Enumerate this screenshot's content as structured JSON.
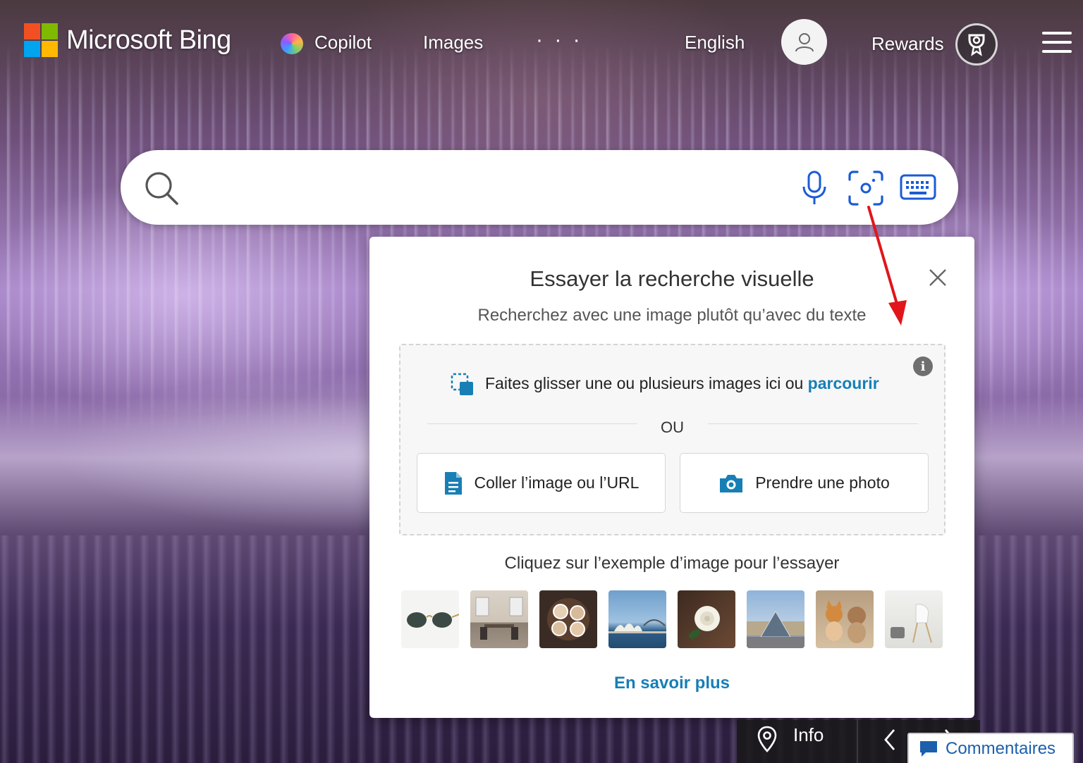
{
  "header": {
    "brand": "Microsoft Bing",
    "brand_colors": [
      "#f25022",
      "#7fba00",
      "#00a4ef",
      "#ffb900"
    ],
    "nav": {
      "copilot": "Copilot",
      "images": "Images",
      "more": "· · ·"
    },
    "language": "English",
    "rewards": "Rewards"
  },
  "search": {
    "placeholder": "",
    "accent_color": "#1a5bd6"
  },
  "visual_search_popup": {
    "title": "Essayer la recherche visuelle",
    "subtitle": "Recherchez avec une image plutôt qu’avec du texte",
    "drop_text": "Faites glisser une ou plusieurs images ici ou",
    "browse_label": "parcourir",
    "info_icon": "i",
    "or_label": "OU",
    "paste_button": "Coller l’image ou l’URL",
    "photo_button": "Prendre une photo",
    "examples_title": "Cliquez sur l’exemple d’image pour l’essayer",
    "example_images": [
      "sunglasses",
      "dining-room",
      "coffee-cups",
      "sydney-opera-house",
      "white-rose",
      "louvre-pyramid",
      "dogs",
      "chair"
    ],
    "learn_more": "En savoir plus",
    "link_color": "#177fb6"
  },
  "footer": {
    "info_label": "Info",
    "feedback_label": "Commentaires"
  }
}
